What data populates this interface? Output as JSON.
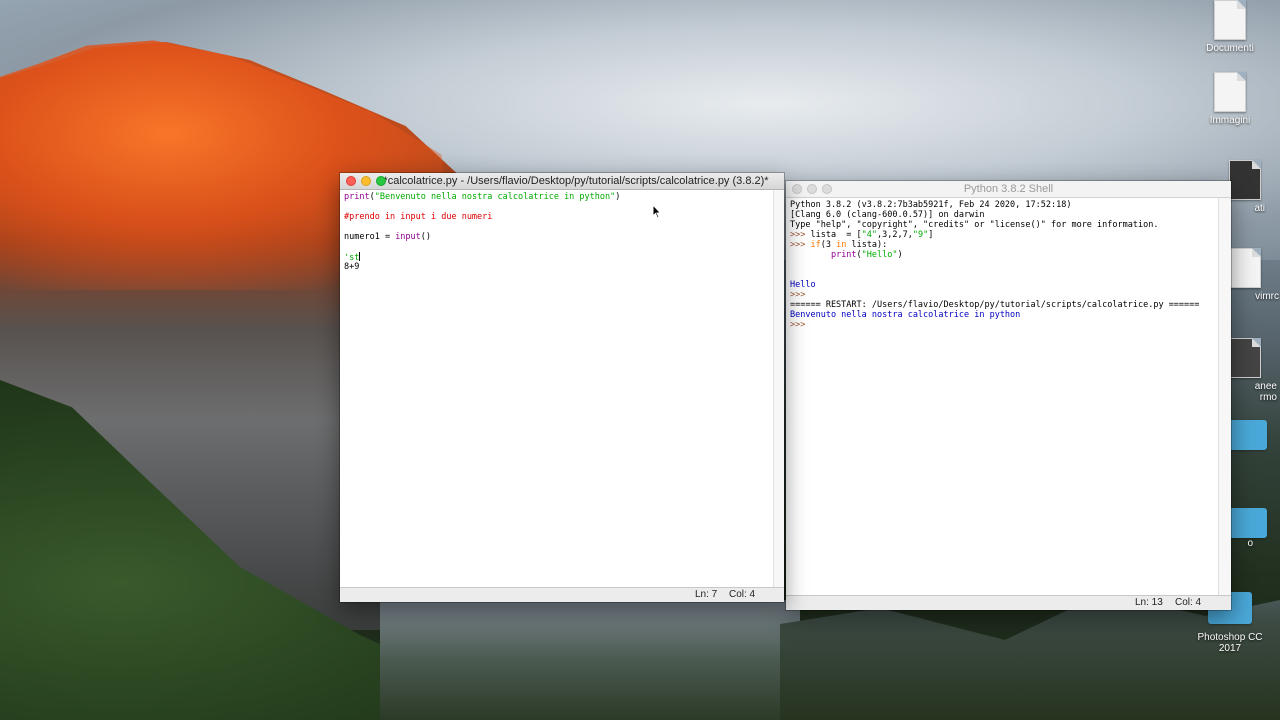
{
  "desktop": {
    "icons": [
      {
        "label": "Documenti",
        "icon": "document-icon"
      },
      {
        "label": "Immagini",
        "icon": "document-icon"
      },
      {
        "label": "ati",
        "icon": "stack-icon"
      },
      {
        "label": "vimrc",
        "icon": "document-icon"
      },
      {
        "label": "anee\nrmo",
        "icon": "document-icon"
      },
      {
        "label": "o",
        "icon": "folder-icon"
      },
      {
        "label": "Photoshop CC\n2017",
        "icon": "folder-icon"
      }
    ]
  },
  "editor": {
    "title": "*calcolatrice.py - /Users/flavio/Desktop/py/tutorial/scripts/calcolatrice.py (3.8.2)*",
    "status_line": "Ln: 7",
    "status_col": "Col: 4",
    "lines": [
      {
        "parts": [
          {
            "t": "print",
            "c": "bi"
          },
          {
            "t": "(",
            "c": ""
          },
          {
            "t": "\"Benvenuto nella nostra calcolatrice in python\"",
            "c": "str"
          },
          {
            "t": ")",
            "c": ""
          }
        ]
      },
      {
        "parts": []
      },
      {
        "parts": [
          {
            "t": "#prendo in input i due numeri",
            "c": "cm"
          }
        ]
      },
      {
        "parts": []
      },
      {
        "parts": [
          {
            "t": "numero1 = ",
            "c": ""
          },
          {
            "t": "input",
            "c": "bi"
          },
          {
            "t": "()",
            "c": ""
          }
        ]
      },
      {
        "parts": []
      },
      {
        "parts": [
          {
            "t": "'st",
            "c": "str"
          }
        ],
        "cursor": true
      },
      {
        "parts": [
          {
            "t": "8+9",
            "c": ""
          }
        ]
      }
    ]
  },
  "shell": {
    "title": "Python 3.8.2 Shell",
    "status_line": "Ln: 13",
    "status_col": "Col: 4",
    "lines": [
      {
        "parts": [
          {
            "t": "Python 3.8.2 (v3.8.2:7b3ab5921f, Feb 24 2020, 17:52:18)",
            "c": ""
          }
        ]
      },
      {
        "parts": [
          {
            "t": "[Clang 6.0 (clang-600.0.57)] on darwin",
            "c": ""
          }
        ]
      },
      {
        "parts": [
          {
            "t": "Type \"help\", \"copyright\", \"credits\" or \"license()\" for more information.",
            "c": ""
          }
        ]
      },
      {
        "parts": [
          {
            "t": ">>> ",
            "c": "prompt"
          },
          {
            "t": "lista  = [",
            "c": ""
          },
          {
            "t": "\"4\"",
            "c": "str"
          },
          {
            "t": ",3,2,7,",
            "c": ""
          },
          {
            "t": "\"9\"",
            "c": "str"
          },
          {
            "t": "]",
            "c": ""
          }
        ]
      },
      {
        "parts": [
          {
            "t": ">>> ",
            "c": "prompt"
          },
          {
            "t": "if",
            "c": "kw"
          },
          {
            "t": "(3 ",
            "c": ""
          },
          {
            "t": "in",
            "c": "kw"
          },
          {
            "t": " lista):",
            "c": ""
          }
        ]
      },
      {
        "parts": [
          {
            "t": "        ",
            "c": ""
          },
          {
            "t": "print",
            "c": "bi"
          },
          {
            "t": "(",
            "c": ""
          },
          {
            "t": "\"Hello\"",
            "c": "str"
          },
          {
            "t": ")",
            "c": ""
          }
        ]
      },
      {
        "parts": []
      },
      {
        "parts": []
      },
      {
        "parts": [
          {
            "t": "Hello",
            "c": "out"
          }
        ]
      },
      {
        "parts": [
          {
            "t": ">>> ",
            "c": "prompt"
          }
        ]
      },
      {
        "parts": [
          {
            "t": "====== RESTART: /Users/flavio/Desktop/py/tutorial/scripts/calcolatrice.py ======",
            "c": ""
          }
        ]
      },
      {
        "parts": [
          {
            "t": "Benvenuto nella nostra calcolatrice in python",
            "c": "out"
          }
        ]
      },
      {
        "parts": [
          {
            "t": ">>> ",
            "c": "prompt"
          }
        ]
      }
    ]
  }
}
